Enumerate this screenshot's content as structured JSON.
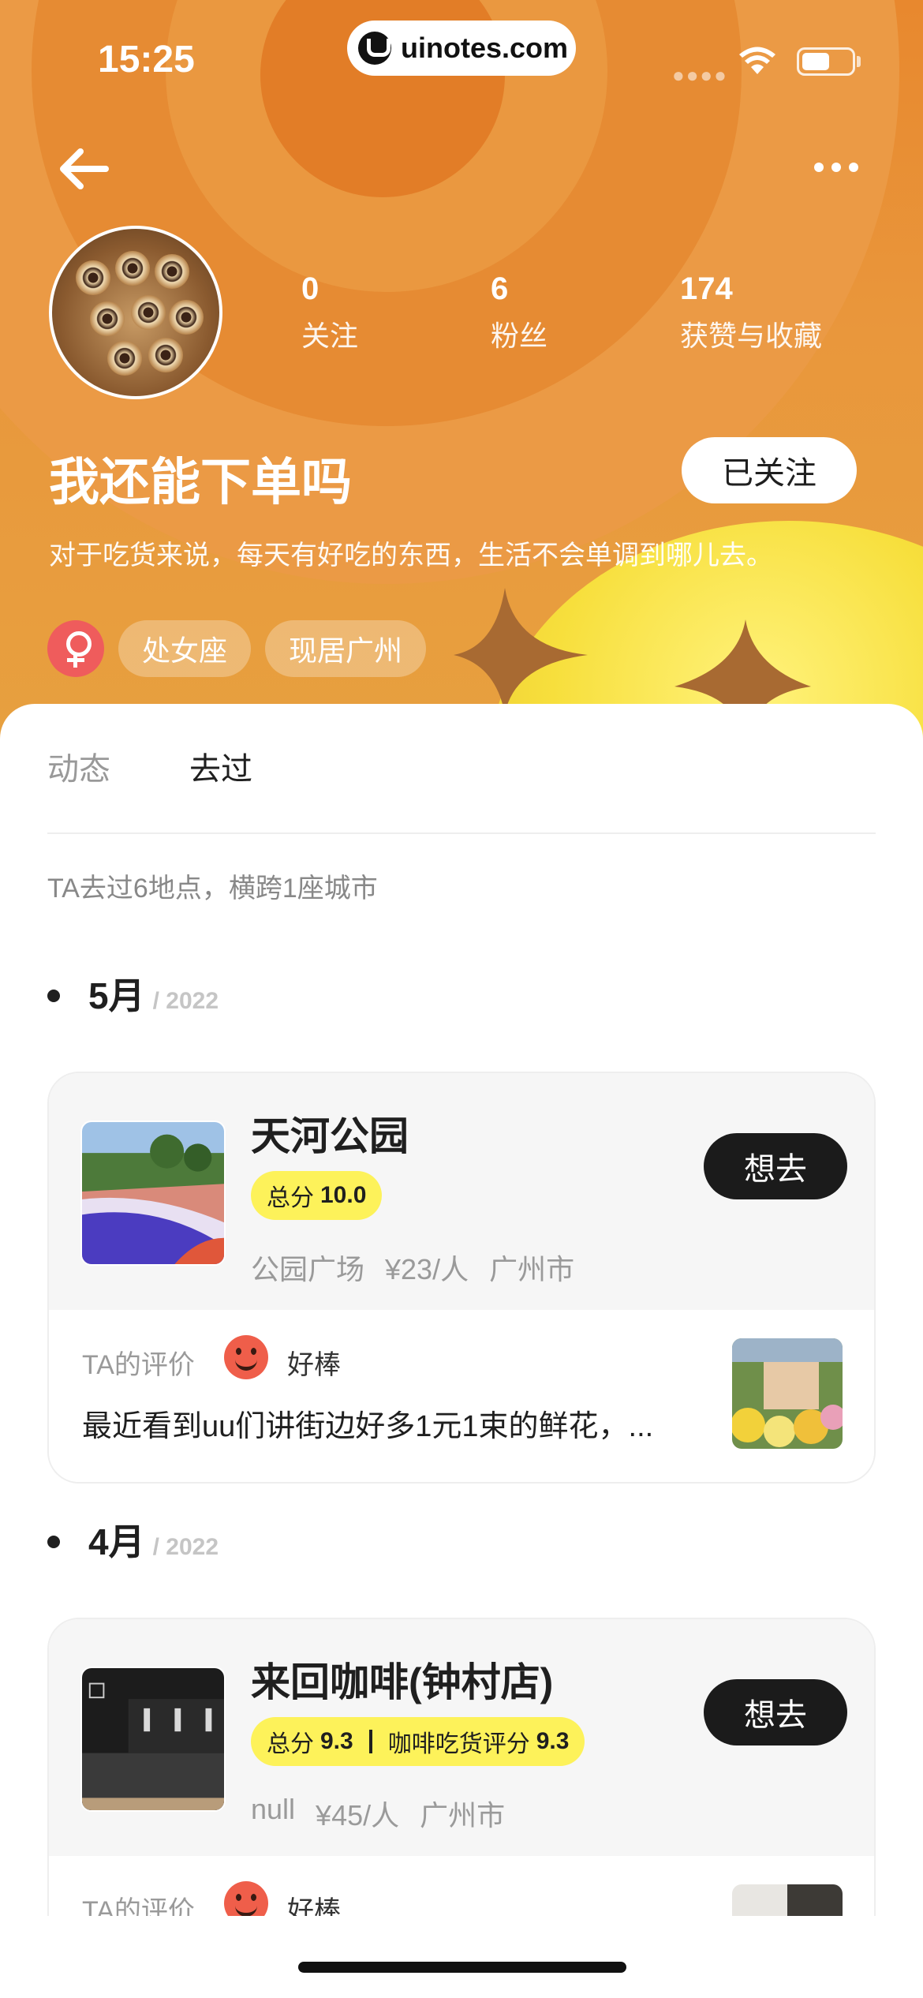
{
  "status_bar": {
    "time": "15:25",
    "url": "uinotes.com"
  },
  "profile": {
    "stats": [
      {
        "value": "0",
        "label": "关注"
      },
      {
        "value": "6",
        "label": "粉丝"
      },
      {
        "value": "174",
        "label": "获赞与收藏"
      }
    ],
    "nickname": "我还能下单吗",
    "follow_label": "已关注",
    "bio": "对于吃货来说，每天有好吃的东西，生活不会单调到哪儿去。",
    "tags": [
      "处女座",
      "现居广州"
    ]
  },
  "tabs": [
    {
      "label": "动态",
      "active": false
    },
    {
      "label": "去过",
      "active": true
    }
  ],
  "summary": "TA去过6地点，横跨1座城市",
  "groups": [
    {
      "month": "5月",
      "year": "/ 2022",
      "place": {
        "name": "天河公园",
        "score_label": "总分",
        "score": "10.0",
        "meta": [
          "公园广场",
          "¥23/人",
          "广州市"
        ],
        "want_label": "想去",
        "review_label": "TA的评价",
        "rating": "好棒",
        "review": "最近看到uu们讲街边好多1元1束的鲜花，..."
      }
    },
    {
      "month": "4月",
      "year": "/ 2022",
      "place": {
        "name": "来回咖啡(钟村店)",
        "score_label": "总分",
        "score": "9.3",
        "extra_score_label": "咖啡吃货评分",
        "extra_score": "9.3",
        "meta": [
          "null",
          "¥45/人",
          "广州市"
        ],
        "want_label": "想去",
        "review_label": "TA的评价",
        "rating": "好棒"
      }
    }
  ],
  "colors": {
    "hero_orange": "#e8882e",
    "score_yellow": "#fdf25a",
    "follow_bg": "#ffffff",
    "want_bg": "#1b1b1b",
    "gender_red": "#ef5c5c"
  }
}
